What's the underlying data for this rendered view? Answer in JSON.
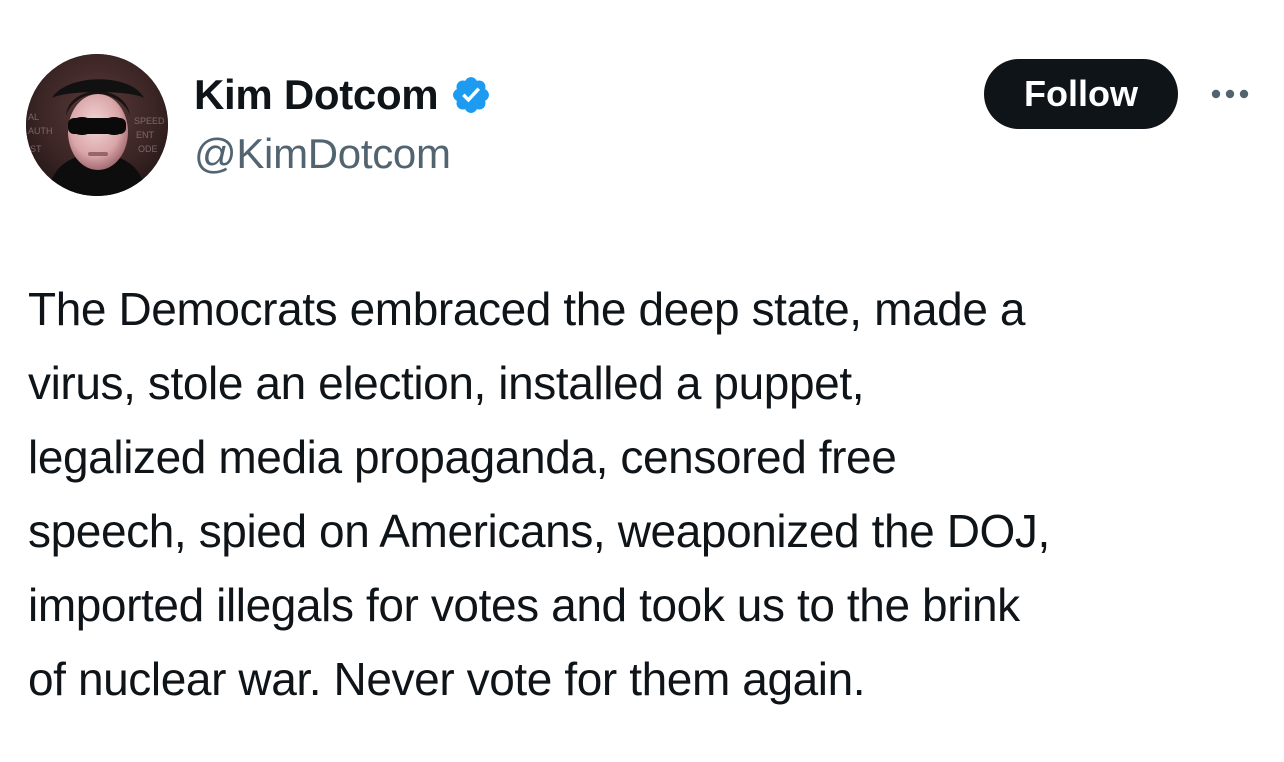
{
  "author": {
    "display_name": "Kim Dotcom",
    "handle": "@KimDotcom",
    "verified": true,
    "avatar_icon": "profile-photo"
  },
  "actions": {
    "follow_label": "Follow",
    "more_icon": "more-horizontal-icon"
  },
  "tweet": {
    "text": "The Democrats embraced the deep state, made a\nvirus, stole an election, installed a puppet,\nlegalized media propaganda, censored free\nspeech, spied on Americans, weaponized the DOJ,\nimported illegals for votes and took us to the brink\nof nuclear war. Never vote for them again."
  },
  "colors": {
    "text": "#0f1419",
    "secondary_text": "#536471",
    "verified_badge": "#1d9bf0",
    "follow_button_bg": "#0f1419",
    "follow_button_text": "#ffffff",
    "background": "#ffffff"
  }
}
